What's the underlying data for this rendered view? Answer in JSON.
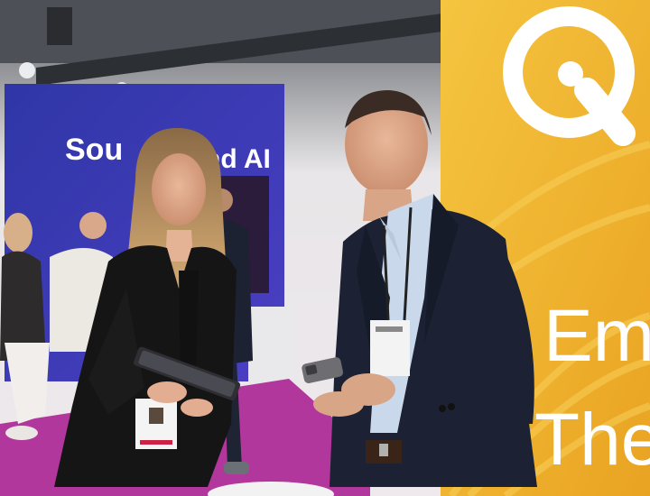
{
  "photo": {
    "booth_sign_left": "Sou",
    "booth_sign_right": "nd AI",
    "banner_text_line1": "Em",
    "banner_text_line2": "The",
    "colors": {
      "banner_yellow": "#f2b92e",
      "banner_orange": "#e79a1f",
      "booth_blue": "#3d3fb8",
      "floor_magenta": "#b2379c",
      "suit_navy": "#1c2233",
      "jacket_black": "#151515",
      "hair_blonde": "#c9a06c"
    }
  }
}
